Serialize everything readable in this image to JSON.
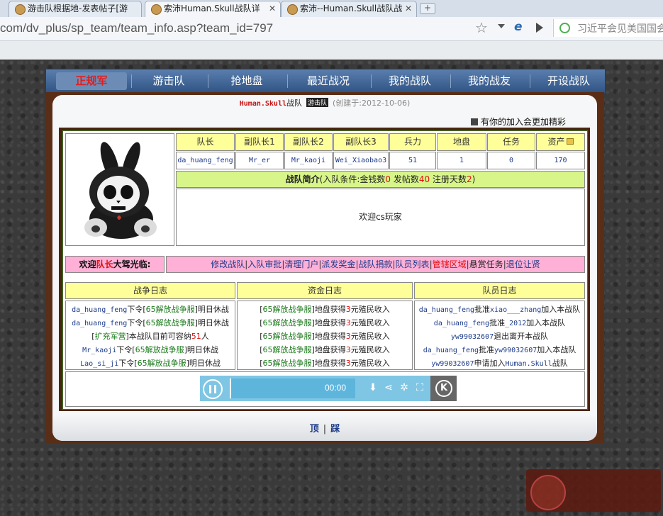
{
  "browser": {
    "tabs": [
      {
        "title": "游击队根据地-发表帖子[游"
      },
      {
        "title": "索沛Human.Skull战队详"
      },
      {
        "title": "索沛--Human.Skull战队战"
      }
    ],
    "new_tab": "+",
    "url": "com/dv_plus/sp_team/team_info.asp?team_id=797",
    "search_text": "习近平会见美国国会"
  },
  "nav": {
    "items": [
      "正规军",
      "游击队",
      "抢地盘",
      "最近战况",
      "我的战队",
      "我的战友",
      "开设战队"
    ]
  },
  "team": {
    "name": "Human.Skull",
    "suffix": "战队",
    "badge": "游击队",
    "created": "(创建于:2012-10-06)",
    "join_msg": "有你的加入会更加精彩"
  },
  "stats": {
    "headers": [
      "队长",
      "副队长1",
      "副队长2",
      "副队长3",
      "兵力",
      "地盘",
      "任务",
      "资产"
    ],
    "values": [
      "da_huang_feng",
      "Mr_er",
      "Mr_kaoji",
      "Wei_Xiaobao3",
      "51",
      "1",
      "0",
      "170"
    ]
  },
  "intro": {
    "title": "战队简介",
    "cond_open": "(入队条件:",
    "cond1_label": "金钱数",
    "cond1_value": "0",
    "cond2_label": "发帖数",
    "cond2_value": "40",
    "cond3_label": "注册天数",
    "cond3_value": "2",
    "cond_close": ")",
    "body": "欢迎cs玩家"
  },
  "welcome": {
    "pre": "欢迎",
    "role": "队长",
    "post": "大驾光临:"
  },
  "actions": [
    "修改战队",
    "入队审批",
    "清理门户",
    "派发奖金",
    "战队捐款",
    "队员列表",
    "管辖区域",
    "悬赏任务",
    "退位让贤"
  ],
  "logs": {
    "war": {
      "title": "战争日志",
      "lines": [
        {
          "user": "da_huang_feng",
          "t1": "下令[",
          "tag": "65解放战争服",
          "t2": "]明日休战"
        },
        {
          "user": "da_huang_feng",
          "t1": "下令[",
          "tag": "65解放战争服",
          "t2": "]明日休战"
        },
        {
          "user": "",
          "t1": "[",
          "tag": "扩充军营",
          "t2": "]本战队目前可容纳",
          "num": "51",
          "t3": "人"
        },
        {
          "user": "Mr_kaoji",
          "t1": "下令[",
          "tag": "65解放战争服",
          "t2": "]明日休战"
        },
        {
          "user": "Lao_si_ji",
          "t1": "下令[",
          "tag": "65解放战争服",
          "t2": "]明日休战"
        }
      ]
    },
    "fund": {
      "title": "资金日志",
      "lines": [
        {
          "t1": "[",
          "tag": "65解放战争服",
          "t2": "]地盘获得",
          "num": "3",
          "t3": "元殖民收入"
        },
        {
          "t1": "[",
          "tag": "65解放战争服",
          "t2": "]地盘获得",
          "num": "3",
          "t3": "元殖民收入"
        },
        {
          "t1": "[",
          "tag": "65解放战争服",
          "t2": "]地盘获得",
          "num": "3",
          "t3": "元殖民收入"
        },
        {
          "t1": "[",
          "tag": "65解放战争服",
          "t2": "]地盘获得",
          "num": "3",
          "t3": "元殖民收入"
        },
        {
          "t1": "[",
          "tag": "65解放战争服",
          "t2": "]地盘获得",
          "num": "3",
          "t3": "元殖民收入"
        }
      ]
    },
    "member": {
      "title": "队员日志",
      "lines": [
        {
          "a": "da_huang_feng",
          "t1": "批准",
          "b": "xiao___zhang",
          "t2": "加入本战队"
        },
        {
          "a": "da_huang_feng",
          "t1": "批准",
          "b": "_2012",
          "t2": "加入本战队"
        },
        {
          "a": "yw99032607",
          "t1": "退出离开本战队",
          "b": "",
          "t2": ""
        },
        {
          "a": "da_huang_feng",
          "t1": "批准",
          "b": "yw99032607",
          "t2": "加入本战队"
        },
        {
          "a": "yw99032607",
          "t1": "申请加入",
          "b": "Human.Skull",
          "t2": "战队"
        }
      ]
    }
  },
  "player": {
    "time": "00:00"
  },
  "footer": {
    "first": "顶",
    "second": "踩"
  },
  "colors": {
    "nav_bg": "#2f5384",
    "header_yellow": "#ffff9a",
    "intro_green": "#d8f58a",
    "action_pink": "#ffb0d6",
    "frame_brown": "#4b2612",
    "accent_red": "#e01010",
    "link_blue": "#1e3c8a",
    "tag_green": "#1c7a1c"
  }
}
